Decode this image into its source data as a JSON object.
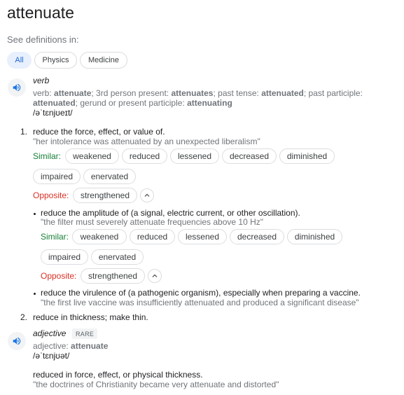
{
  "word": "attenuate",
  "see_definitions_label": "See definitions in:",
  "tabs": [
    {
      "label": "All",
      "active": true
    },
    {
      "label": "Physics",
      "active": false
    },
    {
      "label": "Medicine",
      "active": false
    }
  ],
  "verb": {
    "pos": "verb",
    "forms": {
      "prefix": "verb:",
      "base": "attenuate",
      "t1": "; 3rd person present:",
      "third": "attenuates",
      "t2": "; past tense:",
      "past": "attenuated",
      "t3": "; past participle:",
      "participle": "attenuated",
      "t4": "; gerund or present participle:",
      "gerund": "attenuating"
    },
    "pronunciation": "/əˈtɛnjʊeɪt/",
    "sense1": {
      "number": "1.",
      "definition": "reduce the force, effect, or value of.",
      "example": "\"her intolerance was attenuated by an unexpected liberalism\"",
      "similar_label": "Similar:",
      "similar": [
        "weakened",
        "reduced",
        "lessened",
        "decreased",
        "diminished",
        "impaired",
        "enervated"
      ],
      "opposite_label": "Opposite:",
      "opposite": [
        "strengthened"
      ],
      "subsenses": [
        {
          "definition": "reduce the amplitude of (a signal, electric current, or other oscillation).",
          "example": "\"the filter must severely attenuate frequencies above 10 Hz\"",
          "similar_label": "Similar:",
          "similar": [
            "weakened",
            "reduced",
            "lessened",
            "decreased",
            "diminished",
            "impaired",
            "enervated"
          ],
          "opposite_label": "Opposite:",
          "opposite": [
            "strengthened"
          ]
        },
        {
          "definition": "reduce the virulence of (a pathogenic organism), especially when preparing a vaccine.",
          "example": "\"the first live vaccine was insufficiently attenuated and produced a significant disease\""
        }
      ]
    },
    "sense2": {
      "number": "2.",
      "definition": "reduce in thickness; make thin."
    }
  },
  "adjective": {
    "pos": "adjective",
    "badge": "RARE",
    "forms": {
      "prefix": "adjective:",
      "base": "attenuate"
    },
    "pronunciation": "/əˈtɛnjʊət/",
    "definition": "reduced in force, effect, or physical thickness.",
    "example": "\"the doctrines of Christianity became very attenuate and distorted\""
  },
  "colors": {
    "accent": "#1a73e8",
    "similar": "#188038",
    "opposite": "#d93025"
  },
  "icons": {
    "speaker": "speaker-icon",
    "expand": "chevron-up-icon"
  }
}
